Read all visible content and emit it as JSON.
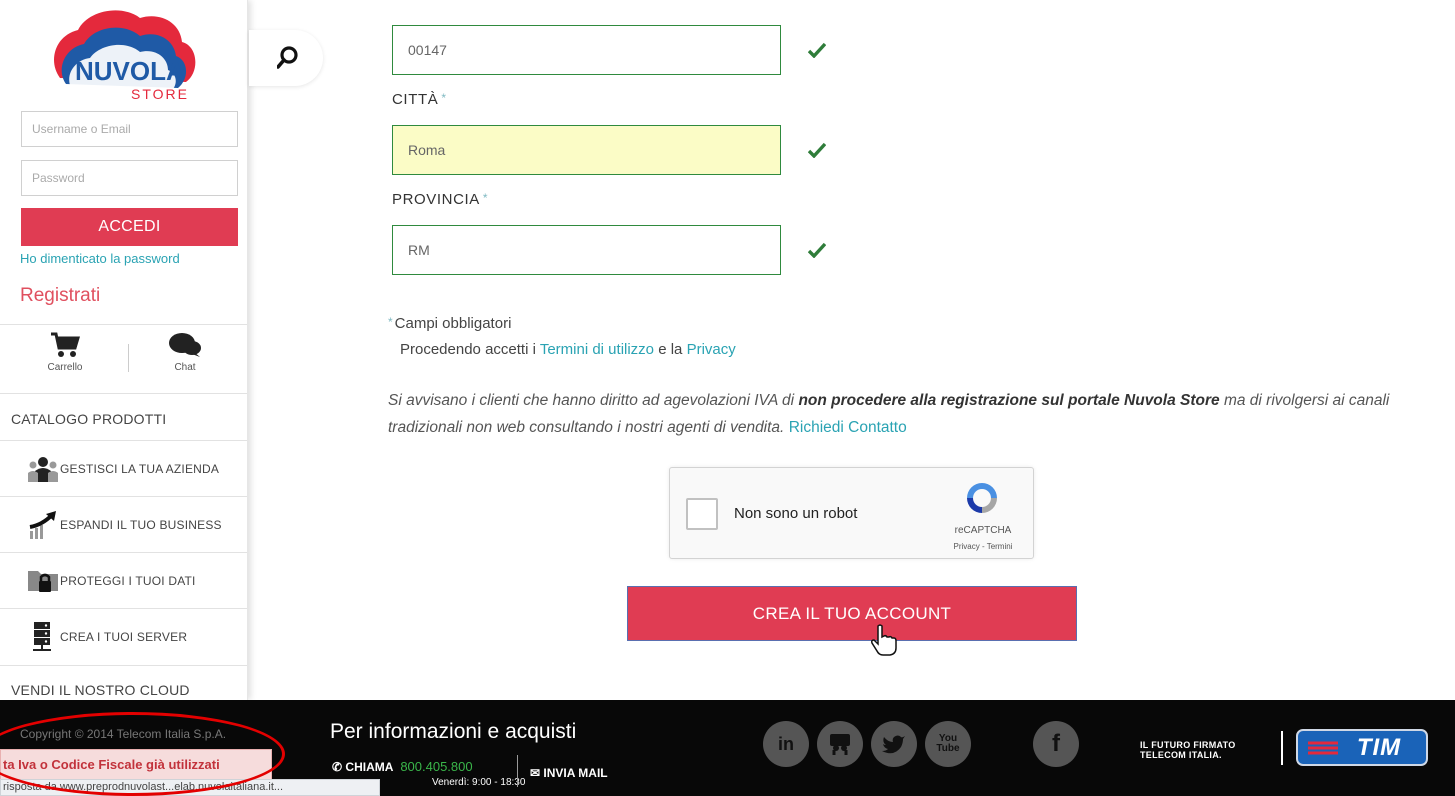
{
  "sidebar": {
    "logo": {
      "title": "NUVOLA",
      "subtitle": "STORE"
    },
    "login": {
      "username_placeholder": "Username o Email",
      "password_placeholder": "Password",
      "submit_label": "ACCEDI",
      "forgot_label": "Ho dimenticato la password",
      "register_label": "Registrati"
    },
    "quick_links": {
      "cart_label": "Carrello",
      "chat_label": "Chat"
    },
    "menu": [
      {
        "label": "CATALOGO PRODOTTI",
        "icon": ""
      },
      {
        "label": "GESTISCI LA TUA AZIENDA",
        "icon": "people-icon"
      },
      {
        "label": "ESPANDI IL TUO BUSINESS",
        "icon": "growth-chart-icon"
      },
      {
        "label": "PROTEGGI I TUOI DATI",
        "icon": "folder-lock-icon"
      },
      {
        "label": "CREA I TUOI SERVER",
        "icon": "server-icon"
      },
      {
        "label": "VENDI IL NOSTRO CLOUD",
        "icon": ""
      }
    ]
  },
  "form": {
    "cap_value": "00147",
    "city_label": "CITTÀ",
    "city_value": "Roma",
    "province_label": "PROVINCIA",
    "province_value": "RM",
    "required_star": "*",
    "required_note": "Campi obbligatori",
    "terms_prefix": "Procedendo accetti i",
    "terms_link": "Termini di utilizzo",
    "terms_and": "e la",
    "privacy_link": "Privacy",
    "iva_note_1": "Si avvisano i clienti che hanno diritto ad agevolazioni IVA di",
    "iva_note_bold": "non procedere alla registrazione sul portale Nuvola Store",
    "iva_note_2": "ma di rivolgersi ai canali tradizionali non web consultando i nostri agenti di vendita.",
    "iva_contact_link": "Richiedi Contatto",
    "captcha": {
      "label": "Non sono un robot",
      "brand": "reCAPTCHA",
      "links": "Privacy - Termini"
    },
    "submit_label": "CREA IL TUO ACCOUNT"
  },
  "footer": {
    "copyright": "Copyright © 2014 Telecom Italia S.p.A.",
    "title": "Per informazioni e acquisti",
    "call_label": "CHIAMA",
    "call_number": "800.405.800",
    "hours": "Venerdì: 9:00 - 18:30",
    "mail_label": "INVIA MAIL",
    "social": [
      {
        "label": "in",
        "icon": "linkedin-icon"
      },
      {
        "label": "",
        "icon": "slideshare-icon"
      },
      {
        "label": "",
        "icon": "twitter-icon"
      },
      {
        "label": "You Tube",
        "icon": "youtube-icon"
      },
      {
        "label": "f",
        "icon": "facebook-icon"
      }
    ],
    "tagline_1": "IL FUTURO FIRMATO",
    "tagline_2": "TELECOM ITALIA.",
    "brand": "TIM"
  },
  "error_toast": "ta Iva o Codice Fiscale già utilizzati",
  "status_bar": "risposta da www.preprodnuvolast...elab.nuvolaitaliana.it..."
}
